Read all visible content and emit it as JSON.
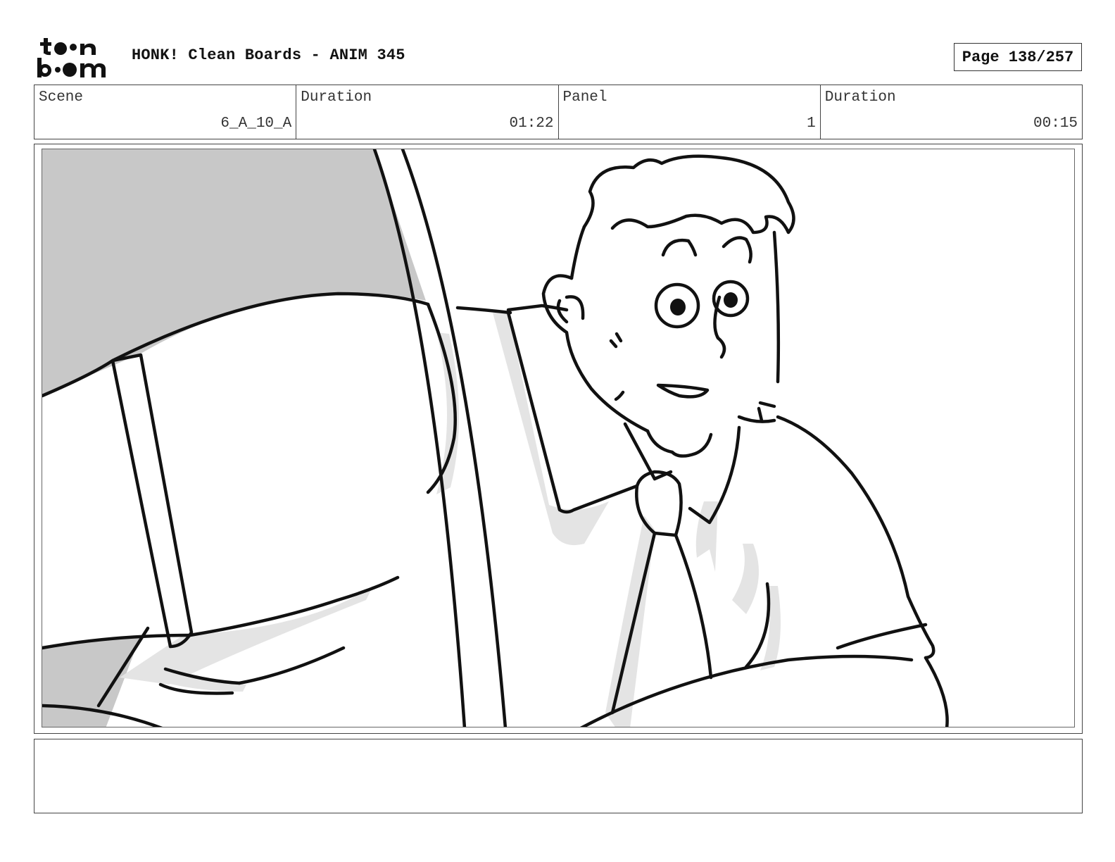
{
  "header": {
    "logo_text": "toon boom",
    "title": "HONK! Clean Boards - ANIM 345",
    "page_label": "Page 138/257"
  },
  "info": [
    {
      "label": "Scene",
      "value": "6_A_10_A"
    },
    {
      "label": "Duration",
      "value": "01:22"
    },
    {
      "label": "Panel",
      "value": "1"
    },
    {
      "label": "Duration",
      "value": "00:15"
    }
  ],
  "panel": {
    "image_name": "storyboard-drawing"
  },
  "notes": {
    "text": ""
  }
}
